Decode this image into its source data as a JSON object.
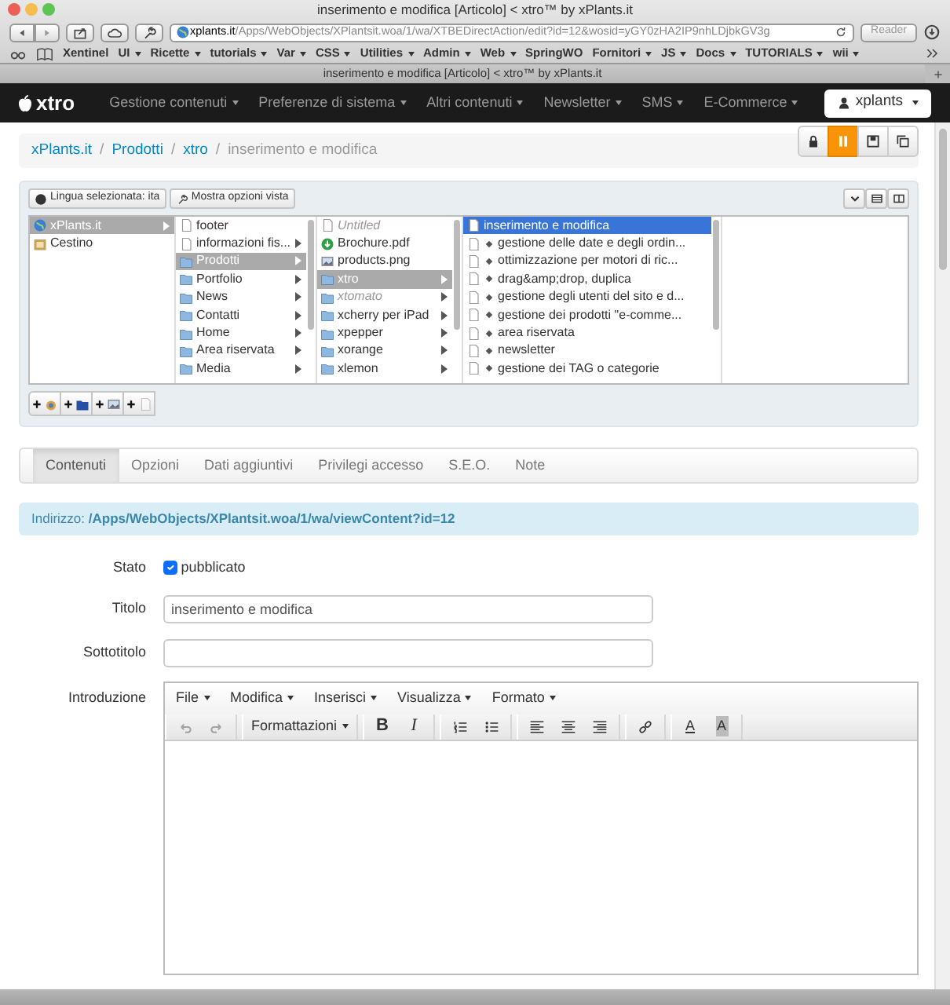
{
  "window": {
    "title": "inserimento e modifica [Articolo] < xtro™ by xPlants.it"
  },
  "toolbar": {
    "url_host": "xplants.it",
    "url_path": "/Apps/WebObjects/XPlantsit.woa/1/wa/XTBEDirectAction/edit?id=12&wosid=yGY0zHA2IP9nhLDjbkGV3g",
    "reader": "Reader"
  },
  "bookmarks": [
    {
      "label": "Xentinel",
      "menu": false
    },
    {
      "label": "UI",
      "menu": true
    },
    {
      "label": "Ricette",
      "menu": true
    },
    {
      "label": "tutorials",
      "menu": true
    },
    {
      "label": "Var",
      "menu": true
    },
    {
      "label": "CSS",
      "menu": true
    },
    {
      "label": "Utilities",
      "menu": true
    },
    {
      "label": "Admin",
      "menu": true
    },
    {
      "label": "Web",
      "menu": true
    },
    {
      "label": "SpringWO",
      "menu": false
    },
    {
      "label": "Fornitori",
      "menu": true
    },
    {
      "label": "JS",
      "menu": true
    },
    {
      "label": "Docs",
      "menu": true
    },
    {
      "label": "TUTORIALS",
      "menu": true
    },
    {
      "label": "wii",
      "menu": true
    }
  ],
  "tab": {
    "title": "inserimento e modifica [Articolo] < xtro™ by xPlants.it"
  },
  "navbar": {
    "brand": "xtro",
    "menus": [
      "Gestione contenuti",
      "Preferenze di sistema",
      "Altri contenuti",
      "Newsletter",
      "SMS",
      "E-Commerce"
    ],
    "user": "xplants"
  },
  "breadcrumb": [
    {
      "label": "xPlants.it",
      "link": true
    },
    {
      "label": "Prodotti",
      "link": true,
      "separator": "/"
    },
    {
      "label": "xtro",
      "link": true,
      "separator": "/"
    },
    {
      "label": "inserimento e modifica",
      "link": false,
      "separator": "/"
    }
  ],
  "actions": [
    {
      "kind": "lock",
      "selected": false
    },
    {
      "kind": "pause",
      "selected": true
    },
    {
      "kind": "save",
      "selected": false
    },
    {
      "kind": "copy",
      "selected": false
    }
  ],
  "browser": {
    "language_button": "Lingua selezionata: ita",
    "view_button": "Mostra opzioni vista",
    "view_modes": [
      {
        "kind": "dropdown"
      },
      {
        "kind": "list"
      },
      {
        "kind": "columns"
      }
    ],
    "columns": [
      {
        "active": false,
        "items": [
          {
            "label": "xPlants.it",
            "kind": "globe",
            "arrow": true,
            "selected": true,
            "dimmed": false,
            "bullet": false
          },
          {
            "label": "Cestino",
            "kind": "trash",
            "arrow": false,
            "selected": false,
            "dimmed": false,
            "bullet": false
          }
        ]
      },
      {
        "active": false,
        "items": [
          {
            "label": "footer",
            "kind": "page",
            "arrow": false,
            "selected": false,
            "dimmed": false,
            "bullet": false
          },
          {
            "label": "informazioni fis...",
            "kind": "page",
            "arrow": true,
            "selected": false,
            "dimmed": false,
            "bullet": false
          },
          {
            "label": "Prodotti",
            "kind": "folder",
            "arrow": true,
            "selected": true,
            "dimmed": false,
            "bullet": false
          },
          {
            "label": "Portfolio",
            "kind": "folder",
            "arrow": true,
            "selected": false,
            "dimmed": false,
            "bullet": false
          },
          {
            "label": "News",
            "kind": "folder",
            "arrow": true,
            "selected": false,
            "dimmed": false,
            "bullet": false
          },
          {
            "label": "Contatti",
            "kind": "folder",
            "arrow": true,
            "selected": false,
            "dimmed": false,
            "bullet": false
          },
          {
            "label": "Home",
            "kind": "folder",
            "arrow": true,
            "selected": false,
            "dimmed": false,
            "bullet": false
          },
          {
            "label": "Area riservata",
            "kind": "folder",
            "arrow": true,
            "selected": false,
            "dimmed": false,
            "bullet": false
          },
          {
            "label": "Media",
            "kind": "folder",
            "arrow": true,
            "selected": false,
            "dimmed": false,
            "bullet": false
          }
        ]
      },
      {
        "active": false,
        "items": [
          {
            "label": "Untitled",
            "kind": "page",
            "arrow": false,
            "selected": false,
            "dimmed": true,
            "bullet": false
          },
          {
            "label": "Brochure.pdf",
            "kind": "pdf",
            "arrow": false,
            "selected": false,
            "dimmed": false,
            "bullet": false
          },
          {
            "label": "products.png",
            "kind": "image",
            "arrow": false,
            "selected": false,
            "dimmed": false,
            "bullet": false
          },
          {
            "label": "xtro",
            "kind": "folder",
            "arrow": true,
            "selected": true,
            "dimmed": false,
            "bullet": false
          },
          {
            "label": "xtomato",
            "kind": "folder",
            "arrow": true,
            "selected": false,
            "dimmed": true,
            "bullet": false
          },
          {
            "label": "xcherry per iPad",
            "kind": "folder",
            "arrow": true,
            "selected": false,
            "dimmed": false,
            "bullet": false
          },
          {
            "label": "xpepper",
            "kind": "folder",
            "arrow": true,
            "selected": false,
            "dimmed": false,
            "bullet": false
          },
          {
            "label": "xorange",
            "kind": "folder",
            "arrow": true,
            "selected": false,
            "dimmed": false,
            "bullet": false
          },
          {
            "label": "xlemon",
            "kind": "folder",
            "arrow": true,
            "selected": false,
            "dimmed": false,
            "bullet": false
          }
        ]
      },
      {
        "active": true,
        "items": [
          {
            "label": "inserimento e modifica",
            "kind": "page",
            "arrow": false,
            "selected": true,
            "dimmed": false,
            "bullet": false
          },
          {
            "label": "gestione delle date e degli ordin...",
            "kind": "page",
            "arrow": false,
            "selected": false,
            "dimmed": false,
            "bullet": true
          },
          {
            "label": "ottimizzazione per motori di ric...",
            "kind": "page",
            "arrow": false,
            "selected": false,
            "dimmed": false,
            "bullet": true
          },
          {
            "label": "drag&amp;drop, duplica",
            "kind": "page",
            "arrow": false,
            "selected": false,
            "dimmed": false,
            "bullet": true
          },
          {
            "label": "gestione degli utenti del sito e d...",
            "kind": "page",
            "arrow": false,
            "selected": false,
            "dimmed": false,
            "bullet": true
          },
          {
            "label": "gestione dei prodotti \"e-comme...",
            "kind": "page",
            "arrow": false,
            "selected": false,
            "dimmed": false,
            "bullet": true
          },
          {
            "label": "area riservata",
            "kind": "page",
            "arrow": false,
            "selected": false,
            "dimmed": false,
            "bullet": true
          },
          {
            "label": "newsletter",
            "kind": "page",
            "arrow": false,
            "selected": false,
            "dimmed": false,
            "bullet": true
          },
          {
            "label": "gestione dei TAG o categorie",
            "kind": "page",
            "arrow": false,
            "selected": false,
            "dimmed": false,
            "bullet": true
          }
        ]
      }
    ],
    "add_buttons": [
      {
        "kind": "site"
      },
      {
        "kind": "folder"
      },
      {
        "kind": "image"
      },
      {
        "kind": "page"
      }
    ]
  },
  "tabs": [
    {
      "label": "Contenuti",
      "selected": true
    },
    {
      "label": "Opzioni",
      "selected": false
    },
    {
      "label": "Dati aggiuntivi",
      "selected": false
    },
    {
      "label": "Privilegi accesso",
      "selected": false
    },
    {
      "label": "S.E.O.",
      "selected": false
    },
    {
      "label": "Note",
      "selected": false
    }
  ],
  "address": "Indirizzo: **/Apps/WebObjects/XPlantsit.woa/1/wa/viewContent?id=12**",
  "form": {
    "status_label": "Stato",
    "published_label": "pubblicato",
    "published": true,
    "title_label": "Titolo",
    "title_value": "inserimento e modifica",
    "subtitle_label": "Sottotitolo",
    "intro_label": "Introduzione"
  },
  "editor": {
    "menus": [
      "File",
      "Modifica",
      "Inserisci",
      "Visualizza",
      "Formato"
    ],
    "tool_groups": [
      [
        {
          "kind": "undo",
          "disabled": true
        },
        {
          "kind": "redo",
          "disabled": true
        }
      ],
      [
        {
          "kind": "formats",
          "label": "Formattazioni",
          "disabled": false
        }
      ],
      [
        {
          "kind": "bold",
          "label": "B",
          "disabled": false
        },
        {
          "kind": "italic",
          "label": "I",
          "disabled": false
        }
      ],
      [
        {
          "kind": "ordered-list",
          "disabled": false
        },
        {
          "kind": "bullet-list",
          "disabled": false
        }
      ],
      [
        {
          "kind": "align-left",
          "disabled": false
        },
        {
          "kind": "align-center",
          "disabled": false
        },
        {
          "kind": "align-right",
          "disabled": false
        }
      ],
      [
        {
          "kind": "link",
          "disabled": false
        }
      ],
      [
        {
          "kind": "text-color",
          "label": "A",
          "disabled": false
        },
        {
          "kind": "background-color",
          "label": "A",
          "disabled": false
        }
      ]
    ]
  }
}
